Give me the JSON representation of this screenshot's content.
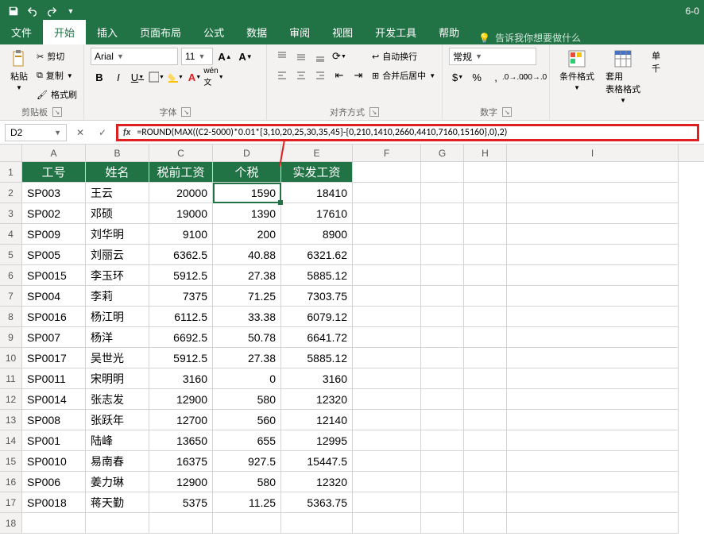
{
  "titlebar": {
    "filename_suffix": "6-0"
  },
  "tabs": {
    "file": "文件",
    "home": "开始",
    "insert": "插入",
    "layout": "页面布局",
    "formulas": "公式",
    "data": "数据",
    "review": "审阅",
    "view": "视图",
    "dev": "开发工具",
    "help": "帮助",
    "tellme": "告诉我你想要做什么"
  },
  "ribbon": {
    "clipboard": {
      "paste": "粘贴",
      "cut": "剪切",
      "copy": "复制",
      "format_painter": "格式刷",
      "label": "剪贴板"
    },
    "font": {
      "name": "Arial",
      "size": "11",
      "label": "字体",
      "bold": "B",
      "italic": "I",
      "underline": "U"
    },
    "alignment": {
      "wrap": "自动换行",
      "merge": "合并后居中",
      "label": "对齐方式"
    },
    "number": {
      "format": "常规",
      "label": "数字"
    },
    "styles": {
      "cond_fmt": "条件格式",
      "table_fmt": "套用\n表格格式",
      "cell_style": "单\n千"
    }
  },
  "namebox": "D2",
  "formula": "=ROUND(MAX((C2-5000)*0.01*{3,10,20,25,30,35,45}-{0,210,1410,2660,4410,7160,15160},0),2)",
  "columns": [
    "A",
    "B",
    "C",
    "D",
    "E",
    "F",
    "G",
    "H",
    "I"
  ],
  "headers": {
    "a": "工号",
    "b": "姓名",
    "c": "税前工资",
    "d": "个税",
    "e": "实发工资"
  },
  "chart_data": {
    "type": "table",
    "columns": [
      "工号",
      "姓名",
      "税前工资",
      "个税",
      "实发工资"
    ],
    "rows": [
      [
        "SP003",
        "王云",
        20000,
        1590,
        18410
      ],
      [
        "SP002",
        "邓硕",
        19000,
        1390,
        17610
      ],
      [
        "SP009",
        "刘华明",
        9100,
        200,
        8900
      ],
      [
        "SP005",
        "刘丽云",
        6362.5,
        40.88,
        6321.62
      ],
      [
        "SP0015",
        "李玉环",
        5912.5,
        27.38,
        5885.12
      ],
      [
        "SP004",
        "李莉",
        7375,
        71.25,
        7303.75
      ],
      [
        "SP0016",
        "杨江明",
        6112.5,
        33.38,
        6079.12
      ],
      [
        "SP007",
        "杨洋",
        6692.5,
        50.78,
        6641.72
      ],
      [
        "SP0017",
        "吴世光",
        5912.5,
        27.38,
        5885.12
      ],
      [
        "SP0011",
        "宋明明",
        3160,
        0,
        3160
      ],
      [
        "SP0014",
        "张志发",
        12900,
        580,
        12320
      ],
      [
        "SP008",
        "张跃年",
        12700,
        560,
        12140
      ],
      [
        "SP001",
        "陆峰",
        13650,
        655,
        12995
      ],
      [
        "SP0010",
        "易南春",
        16375,
        927.5,
        15447.5
      ],
      [
        "SP006",
        "姜力琳",
        12900,
        580,
        12320
      ],
      [
        "SP0018",
        "蒋天勤",
        5375,
        11.25,
        5363.75
      ]
    ]
  }
}
